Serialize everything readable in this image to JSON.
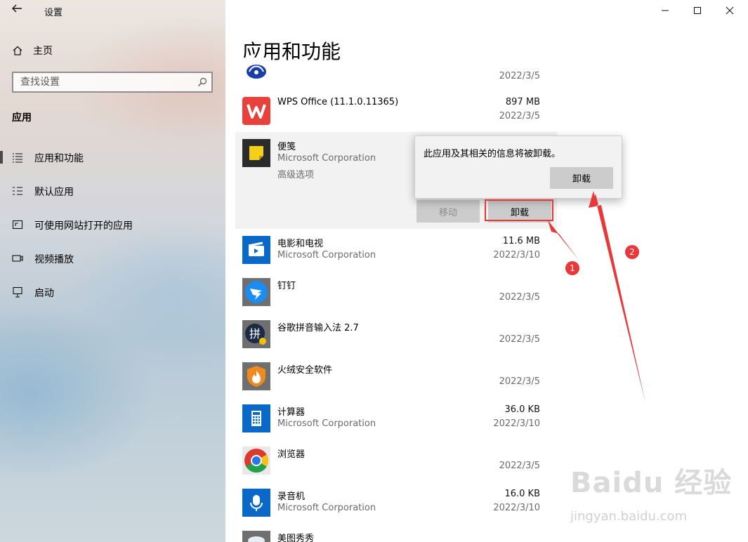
{
  "window": {
    "title": "设置",
    "back_icon": "back-arrow-icon",
    "controls": [
      "minimize",
      "maximize",
      "close"
    ]
  },
  "sidebar": {
    "home_label": "主页",
    "search_placeholder": "查找设置",
    "section_title": "应用",
    "items": [
      {
        "label": "应用和功能",
        "icon": "apps-list-icon",
        "active": true
      },
      {
        "label": "默认应用",
        "icon": "default-apps-icon",
        "active": false
      },
      {
        "label": "可使用网站打开的应用",
        "icon": "web-apps-icon",
        "active": false
      },
      {
        "label": "视频播放",
        "icon": "video-icon",
        "active": false
      },
      {
        "label": "启动",
        "icon": "startup-icon",
        "active": false
      }
    ]
  },
  "main": {
    "page_title": "应用和功能",
    "apps": [
      {
        "name": "",
        "publisher": "",
        "size": "",
        "date": "2022/3/5",
        "icon": "partial-app-icon"
      },
      {
        "name": "WPS Office (11.1.0.11365)",
        "publisher": "",
        "size": "897 MB",
        "date": "2022/3/5",
        "icon": "wps-icon"
      },
      {
        "name": "便笺",
        "publisher": "Microsoft Corporation",
        "size": "",
        "date": "",
        "icon": "sticky-notes-icon"
      },
      {
        "name": "电影和电视",
        "publisher": "Microsoft Corporation",
        "size": "11.6 MB",
        "date": "2022/3/10",
        "icon": "movies-tv-icon"
      },
      {
        "name": "钉钉",
        "publisher": "",
        "size": "",
        "date": "2022/3/5",
        "icon": "dingtalk-icon"
      },
      {
        "name": "谷歌拼音输入法 2.7",
        "publisher": "",
        "size": "",
        "date": "2022/3/5",
        "icon": "google-pinyin-icon"
      },
      {
        "name": "火绒安全软件",
        "publisher": "",
        "size": "",
        "date": "2022/3/5",
        "icon": "huorong-icon"
      },
      {
        "name": "计算器",
        "publisher": "Microsoft Corporation",
        "size": "36.0 KB",
        "date": "2022/3/10",
        "icon": "calculator-icon"
      },
      {
        "name": "浏览器",
        "publisher": "",
        "size": "",
        "date": "2022/3/5",
        "icon": "chrome-icon"
      },
      {
        "name": "录音机",
        "publisher": "Microsoft Corporation",
        "size": "16.0 KB",
        "date": "2022/3/10",
        "icon": "voice-recorder-icon"
      },
      {
        "name": "美图秀秀",
        "publisher": "",
        "size": "",
        "date": "",
        "icon": "meitu-icon"
      }
    ],
    "expanded": {
      "advanced_options": "高级选项",
      "move_label": "移动",
      "uninstall_label": "卸载"
    },
    "flyout": {
      "message": "此应用及其相关的信息将被卸载。",
      "confirm_label": "卸载"
    }
  },
  "annotations": {
    "step1": "1",
    "step2": "2",
    "color": "#e8383a"
  },
  "watermark": {
    "brand": "Baidu 经验",
    "url": "jingyan.baidu.com"
  }
}
